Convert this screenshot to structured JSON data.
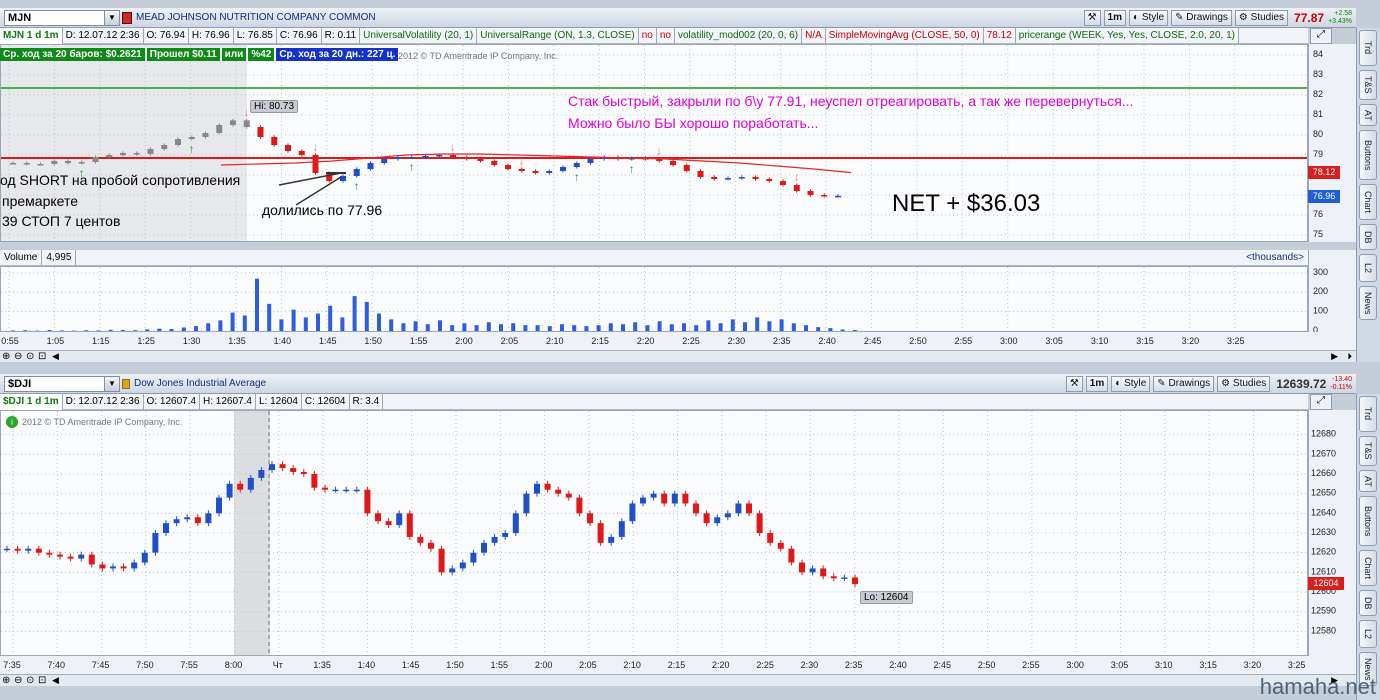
{
  "top": {
    "symbol": "MJN",
    "company": "MEAD JOHNSON NUTRITION COMPANY COMMON",
    "period_btn": "1m",
    "style_btn": "Style",
    "drawings_btn": "Drawings",
    "studies_btn": "Studies",
    "last_price": "77.87",
    "change_abs": "+2.58",
    "change_pct": "+3.43%",
    "info_items": [
      "MJN 1 d 1m",
      "D: 12.07.12 2:36",
      "O: 76.94",
      "H: 76.96",
      "L: 76.85",
      "C: 76.96",
      "R: 0.11",
      "UniversalVolatility (20, 1)",
      "UniversalRange (ON, 1.3, CLOSE)",
      "no",
      "no",
      "volatility_mod002 (20, 0, 6)",
      "N/A",
      "SimpleMovingAvg (CLOSE, 50, 0)",
      "78.12",
      "pricerange (WEEK, Yes, Yes, CLOSE, 2.0, 20, 1)"
    ],
    "stat_items": [
      "Ср. ход за 20 баров: $0.2621",
      "Прошел $0.11",
      "или",
      "%42",
      "Ср. ход за 20 дн.: 227 ц."
    ],
    "copyright": "2012 © TD Ameritrade IP Company, Inc.",
    "hi_label": "Hi: 80.73",
    "note1": "Стак быстрый, закрыли по б\\у 77.91, неуспел отреагировать, а так же перевернуться...",
    "note2": "Можно было БЫ хорошо поработать...",
    "left_note1": "од SHORT на пробой сопротивления",
    "left_note2": "премаркете",
    "left_note3": "39 СТОП  7 центов",
    "split_note": "долились по 77.96",
    "net_note": "NET + $36.03",
    "badge_red": "78.12",
    "badge_blue": "76.96",
    "volume_label": "Volume",
    "volume_value": "4,995",
    "thousands": "<thousands>"
  },
  "bottom": {
    "symbol": "$DJI",
    "company": "Dow Jones Industrial Average",
    "period_btn": "1m",
    "style_btn": "Style",
    "drawings_btn": "Drawings",
    "studies_btn": "Studies",
    "last_price": "12639.72",
    "change_abs": "-13.40",
    "change_pct": "-0.11%",
    "info_items": [
      "$DJI 1 d 1m",
      "D: 12.07.12 2:36",
      "O: 12607.4",
      "H: 12607.4",
      "L: 12604",
      "C: 12604",
      "R: 3.4"
    ],
    "copyright": "2012 © TD Ameritrade IP Company, Inc.",
    "lo_label": "Lo: 12604",
    "badge_red": "12604"
  },
  "sidebar_tabs_top": [
    "Trd",
    "T&S",
    "AT",
    "Buttons",
    "Chart",
    "DB",
    "L2",
    "News"
  ],
  "sidebar_tabs_bottom": [
    "Trd",
    "T&S",
    "AT",
    "Buttons",
    "Chart",
    "DB",
    "L2",
    "News"
  ],
  "watermark": "hamaha.net",
  "chart_data": [
    {
      "type": "candlestick",
      "title": "MJN 1 d 1m",
      "ylim": [
        74.7,
        84.5
      ],
      "y_ticks": [
        75,
        76,
        77,
        78,
        79,
        80,
        81,
        82,
        83,
        84
      ],
      "x_ticks": [
        "0:55",
        "1:05",
        "1:15",
        "1:25",
        "1:30",
        "1:35",
        "1:40",
        "1:45",
        "1:50",
        "1:55",
        "2:00",
        "2:05",
        "2:10",
        "2:15",
        "2:20",
        "2:25",
        "2:30",
        "2:35",
        "2:40",
        "2:45",
        "2:50",
        "2:55",
        "3:00",
        "3:05",
        "3:10",
        "3:15",
        "3:20",
        "3:25"
      ],
      "resistance_line": 78.85,
      "green_line": 82.35,
      "moving_average": [
        78.5,
        78.55,
        78.6,
        78.7,
        78.85,
        79.0,
        79.05,
        79.05,
        79.0,
        78.95,
        78.9,
        78.85,
        78.8,
        78.7,
        78.6,
        78.45,
        78.3,
        78.12
      ],
      "close": [
        78.6,
        78.55,
        78.55,
        78.7,
        78.6,
        78.65,
        78.9,
        79.0,
        79.1,
        79.05,
        79.3,
        79.5,
        79.8,
        79.9,
        80.1,
        80.5,
        80.73,
        80.4,
        79.9,
        79.5,
        79.2,
        79.0,
        78.1,
        77.7,
        77.95,
        78.3,
        78.6,
        78.8,
        78.9,
        78.9,
        78.95,
        79.0,
        78.9,
        78.8,
        78.7,
        78.5,
        78.3,
        78.2,
        78.1,
        78.2,
        78.4,
        78.6,
        78.8,
        78.9,
        78.8,
        78.85,
        78.8,
        78.7,
        78.5,
        78.2,
        77.9,
        77.8,
        77.85,
        77.9,
        77.8,
        77.7,
        77.5,
        77.2,
        77.0,
        76.95,
        76.96
      ]
    },
    {
      "type": "bar",
      "title": "Volume",
      "ylabel": "thousands",
      "ylim": [
        0,
        330
      ],
      "y_ticks": [
        0,
        100,
        200,
        300
      ],
      "values": [
        3,
        4,
        2,
        5,
        3,
        2,
        4,
        3,
        6,
        5,
        4,
        8,
        12,
        10,
        18,
        25,
        40,
        55,
        95,
        80,
        270,
        140,
        60,
        110,
        70,
        90,
        130,
        70,
        180,
        150,
        90,
        60,
        40,
        50,
        35,
        55,
        30,
        40,
        30,
        45,
        35,
        40,
        30,
        30,
        25,
        35,
        30,
        25,
        30,
        40,
        35,
        45,
        30,
        50,
        35,
        40,
        30,
        55,
        40,
        60,
        45,
        70,
        50,
        60,
        40,
        30,
        20,
        15,
        8,
        5
      ]
    },
    {
      "type": "candlestick",
      "title": "$DJI 1 d 1m",
      "ylim": [
        12568,
        12692
      ],
      "y_ticks": [
        12580,
        12590,
        12600,
        12610,
        12620,
        12630,
        12640,
        12650,
        12660,
        12670,
        12680
      ],
      "x_ticks": [
        "7:35",
        "7:40",
        "7:45",
        "7:50",
        "7:55",
        "8:00",
        "Чт",
        "1:35",
        "1:40",
        "1:45",
        "1:50",
        "1:55",
        "2:00",
        "2:05",
        "2:10",
        "2:15",
        "2:20",
        "2:25",
        "2:30",
        "2:35",
        "2:40",
        "2:45",
        "2:50",
        "2:55",
        "3:00",
        "3:05",
        "3:10",
        "3:15",
        "3:20",
        "3:25"
      ],
      "close": [
        12622,
        12621,
        12622,
        12620,
        12619,
        12618,
        12617,
        12619,
        12614,
        12612,
        12613,
        12612,
        12615,
        12620,
        12630,
        12635,
        12637,
        12638,
        12635,
        12640,
        12648,
        12655,
        12652,
        12658,
        12662,
        12665,
        12663,
        12661,
        12660,
        12653,
        12652,
        12652,
        12652,
        12652,
        12640,
        12636,
        12634,
        12640,
        12628,
        12625,
        12622,
        12610,
        12612,
        12615,
        12620,
        12625,
        12628,
        12630,
        12640,
        12650,
        12655,
        12652,
        12650,
        12648,
        12640,
        12635,
        12625,
        12628,
        12636,
        12645,
        12648,
        12650,
        12645,
        12650,
        12645,
        12640,
        12635,
        12638,
        12640,
        12645,
        12640,
        12630,
        12625,
        12622,
        12615,
        12610,
        12612,
        12608,
        12607,
        12607.4,
        12604
      ]
    }
  ]
}
